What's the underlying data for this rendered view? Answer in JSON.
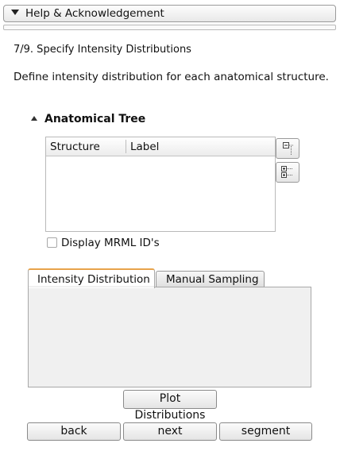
{
  "help": {
    "label": "Help & Acknowledgement"
  },
  "step": {
    "title": "7/9. Specify Intensity Distributions",
    "description": "Define intensity distribution for each anatomical structure."
  },
  "tree": {
    "title": "Anatomical Tree",
    "columns": [
      "Structure",
      "Label"
    ],
    "rows": [],
    "collapse_icon": "collapse-all-icon",
    "expand_icon": "expand-all-icon"
  },
  "mrml": {
    "label": "Display MRML ID's",
    "checked": false
  },
  "tabs": [
    {
      "label": "Intensity Distribution",
      "active": true
    },
    {
      "label": "Manual Sampling",
      "active": false
    }
  ],
  "plot_button": "Plot Distributions",
  "nav": {
    "back": "back",
    "next": "next",
    "segment": "segment"
  },
  "colors": {
    "active_tab_accent": "#e8a34a",
    "panel_bg": "#f0f0f0"
  }
}
